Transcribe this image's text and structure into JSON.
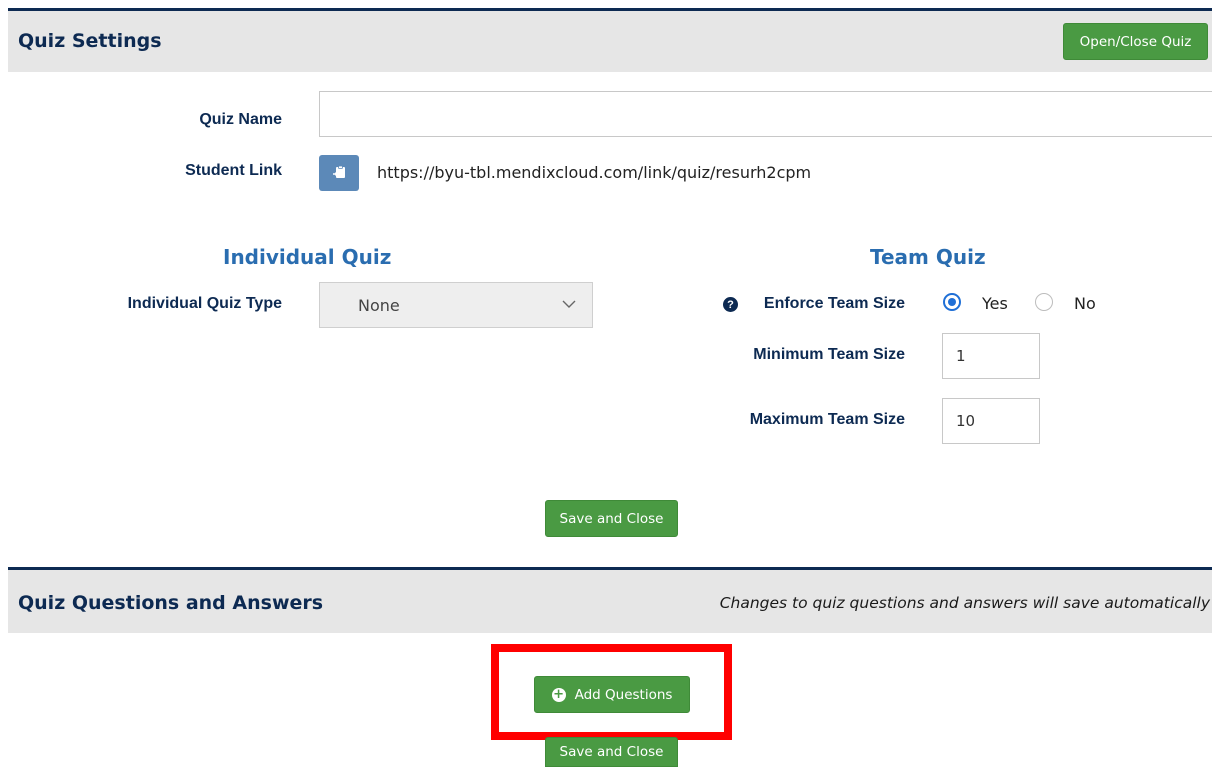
{
  "quiz_settings": {
    "title": "Quiz Settings",
    "open_close_label": "Open/Close Quiz",
    "quiz_name_label": "Quiz Name",
    "quiz_name_value": "",
    "student_link_label": "Student Link",
    "student_link_url": "https://byu-tbl.mendixcloud.com/link/quiz/resurh2cpm",
    "copy_icon": "clipboard-icon"
  },
  "individual_quiz": {
    "heading": "Individual Quiz",
    "type_label": "Individual Quiz Type",
    "type_value": "None"
  },
  "team_quiz": {
    "heading": "Team Quiz",
    "enforce_label": "Enforce Team Size",
    "enforce_options": [
      "Yes",
      "No"
    ],
    "enforce_selected": "Yes",
    "min_label": "Minimum Team Size",
    "min_value": "1",
    "max_label": "Maximum Team Size",
    "max_value": "10"
  },
  "save_close_label": "Save and Close",
  "quiz_questions": {
    "title": "Quiz Questions and Answers",
    "note": "Changes to quiz questions and answers will save automatically",
    "add_label": "Add Questions",
    "save_close_label": "Save and Close"
  },
  "colors": {
    "green": "#4a9a43",
    "navy": "#0d2a52",
    "heading_blue": "#2a6db0",
    "highlight_red": "#ff0000"
  }
}
